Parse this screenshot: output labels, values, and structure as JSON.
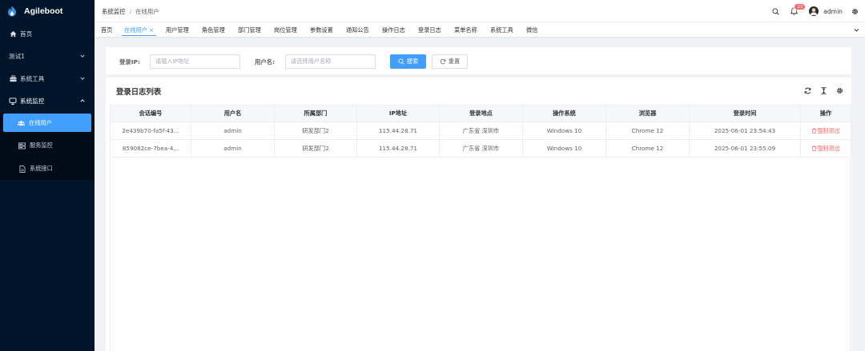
{
  "app": {
    "title": "Agileboot"
  },
  "sidebar": {
    "items": [
      {
        "label": "首页",
        "icon": "home-icon"
      },
      {
        "label": "测试1",
        "icon": ""
      },
      {
        "label": "系统工具",
        "icon": "toolbox-icon"
      },
      {
        "label": "系统监控",
        "icon": "monitor-icon"
      }
    ],
    "sub_items": [
      {
        "label": "在线用户",
        "icon": "users-icon"
      },
      {
        "label": "服务监控",
        "icon": "server-icon"
      },
      {
        "label": "系统接口",
        "icon": "document-icon"
      }
    ]
  },
  "header": {
    "breadcrumb": [
      "系统监控",
      "在线用户"
    ],
    "separator": "/",
    "notification_count": "13",
    "username": "admin"
  },
  "tags": [
    {
      "label": "首页"
    },
    {
      "label": "在线用户 ×"
    },
    {
      "label": "用户管理"
    },
    {
      "label": "角色管理"
    },
    {
      "label": "部门管理"
    },
    {
      "label": "岗位管理"
    },
    {
      "label": "参数设置"
    },
    {
      "label": "通知公告"
    },
    {
      "label": "操作日志"
    },
    {
      "label": "登录日志"
    },
    {
      "label": "菜单名称"
    },
    {
      "label": "系统工具"
    },
    {
      "label": "微信"
    }
  ],
  "search": {
    "ip_label": "登录IP:",
    "ip_placeholder": "请输入IP地址",
    "user_label": "用户名:",
    "user_placeholder": "请选择用户名称",
    "search_button": "搜索",
    "reset_button": "重置"
  },
  "table": {
    "title": "登录日志列表",
    "columns": [
      "会话编号",
      "用户名",
      "所属部门",
      "IP地址",
      "登录地点",
      "操作系统",
      "浏览器",
      "登录时间",
      "操作"
    ],
    "rows": [
      [
        "2e439b70-fa5f-43...",
        "admin",
        "研发部门2",
        "115.44.28.71",
        "广东省 深圳市",
        "Windows 10",
        "Chrome 12",
        "2025-06-01 23:54:43",
        "强制退出"
      ],
      [
        "859082ce-7bea-4...",
        "admin",
        "研发部门2",
        "115.44.28.71",
        "广东省 深圳市",
        "Windows 10",
        "Chrome 12",
        "2025-06-01 23:55:09",
        "强制退出"
      ]
    ]
  },
  "colors": {
    "primary": "#409eff",
    "sidebar": "#001529",
    "danger": "#f56c6c"
  }
}
